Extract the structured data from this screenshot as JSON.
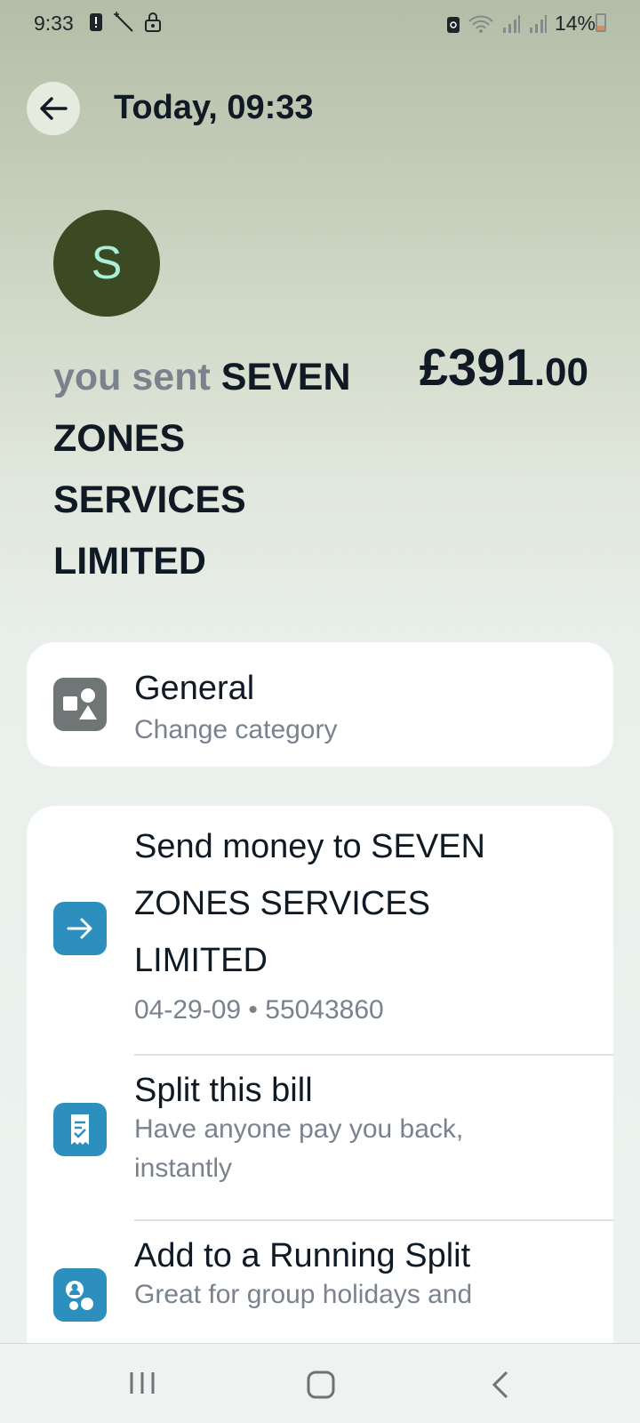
{
  "status_bar": {
    "time": "9:33",
    "battery": "14%",
    "icons_left": [
      "alert-icon",
      "magic-wand-icon",
      "lock-icon"
    ],
    "icons_right": [
      "data-saver-icon",
      "wifi-icon",
      "signal-icon",
      "signal-icon"
    ]
  },
  "header": {
    "title": "Today, 09:33"
  },
  "transaction": {
    "avatar_letter": "S",
    "prefix": "you sent",
    "payee": "SEVEN ZONES SERVICES LIMITED",
    "amount_main": "£391",
    "amount_cents": ".00"
  },
  "category": {
    "title": "General",
    "subtitle": "Change category"
  },
  "actions": [
    {
      "title": "Send money to SEVEN ZONES SERVICES LIMITED",
      "subtitle": "04-29-09 • 55043860"
    },
    {
      "title": "Split this bill",
      "subtitle": "Have anyone pay you back, instantly"
    },
    {
      "title": "Add to a Running Split",
      "subtitle": "Great for group holidays and"
    }
  ],
  "colors": {
    "accent_blue": "#2d8fbd",
    "avatar_bg": "#3b4a22",
    "avatar_fg": "#a9f0d8"
  }
}
